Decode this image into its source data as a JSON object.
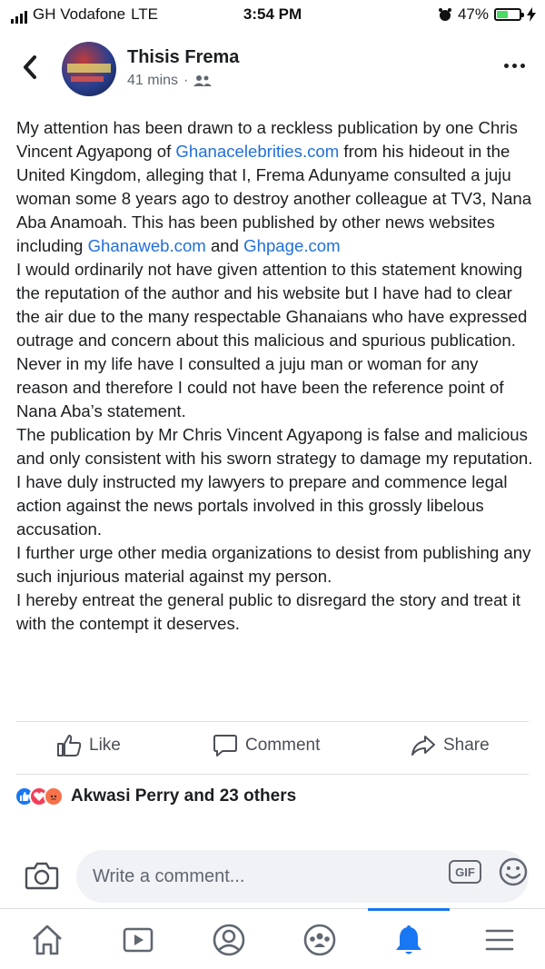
{
  "status_bar": {
    "carrier": "GH Vodafone",
    "network": "LTE",
    "time": "3:54 PM",
    "battery": "47%",
    "battery_level": 0.47
  },
  "post": {
    "author": "Thisis Frema",
    "time_ago": "41 mins",
    "separator": "·",
    "audience_icon": "friends-icon",
    "paragraphs": [
      {
        "parts": [
          {
            "text": "My attention has been drawn to a reckless publication by one Chris Vincent Agyapong of "
          },
          {
            "text": "Ghanacelebrities.com",
            "link": true
          },
          {
            "text": " from his hideout in the United Kingdom, alleging that I, Frema Adunyame consulted a juju woman some 8 years ago to destroy another colleague at TV3, Nana Aba Anamoah. This has been published by other news websites including "
          },
          {
            "text": "Ghanaweb.com",
            "link": true
          },
          {
            "text": " and "
          },
          {
            "text": "Ghpage.com",
            "link": true
          }
        ]
      },
      {
        "parts": [
          {
            "text": "I would ordinarily not have given attention to this statement knowing the reputation of the author and his website but I have had to clear the air due to the many respectable Ghanaians who have expressed outrage and concern about this malicious and spurious publication."
          }
        ]
      },
      {
        "parts": [
          {
            "text": "Never in my life have I consulted a juju man or woman for any reason and therefore I could not have been the reference point of Nana Aba’s statement."
          }
        ]
      },
      {
        "parts": [
          {
            "text": "The publication by Mr Chris Vincent Agyapong is false and malicious and only consistent with his sworn strategy to damage my reputation."
          }
        ]
      },
      {
        "parts": [
          {
            "text": "I have duly instructed my lawyers to prepare and commence legal action against the news portals involved in this grossly libelous accusation."
          }
        ]
      },
      {
        "parts": [
          {
            "text": "I further urge other media organizations to desist from publishing any such injurious material against my person."
          }
        ]
      },
      {
        "parts": [
          {
            "text": "I hereby entreat the general public to disregard the story and treat it with the contempt it deserves."
          }
        ]
      }
    ]
  },
  "actions": {
    "like": "Like",
    "comment": "Comment",
    "share": "Share"
  },
  "reactions": {
    "types": [
      "like",
      "love",
      "angry"
    ],
    "summary": "Akwasi Perry and 23 others"
  },
  "composer": {
    "placeholder": "Write a comment...",
    "gif_label": "GIF"
  },
  "bottom_nav": {
    "items": [
      "home-icon",
      "watch-icon",
      "profile-icon",
      "groups-icon",
      "notifications-icon",
      "menu-icon"
    ],
    "active": "notifications-icon"
  },
  "colors": {
    "link": "#216fdb",
    "accent": "#1877f2",
    "text": "#1c1e21",
    "secondary": "#606770"
  }
}
